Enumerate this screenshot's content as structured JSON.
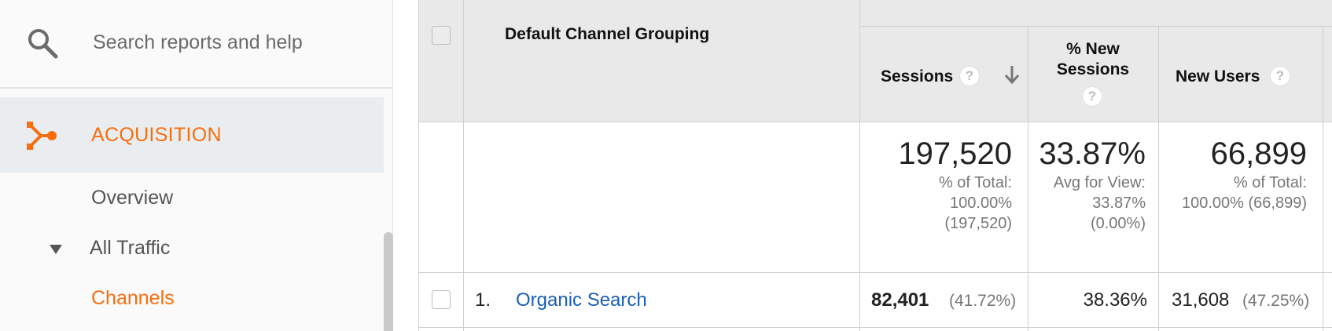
{
  "search": {
    "placeholder": "Search reports and help"
  },
  "nav": {
    "section_label": "ACQUISITION",
    "items": [
      {
        "label": "Overview"
      },
      {
        "label": "All Traffic"
      },
      {
        "label": "Channels",
        "active": true
      }
    ]
  },
  "table": {
    "dimension_header": "Default Channel Grouping",
    "columns": [
      {
        "label": "Sessions",
        "sorted": "descending"
      },
      {
        "label": "% New Sessions"
      },
      {
        "label": "New Users"
      }
    ],
    "totals": {
      "sessions": {
        "value": "197,520",
        "line1": "% of Total:",
        "line2": "100.00%",
        "line3": "(197,520)"
      },
      "new_sessions": {
        "value": "33.87%",
        "line1": "Avg for View:",
        "line2": "33.87%",
        "line3": "(0.00%)"
      },
      "new_users": {
        "value": "66,899",
        "line1": "% of Total:",
        "line2": "100.00% (66,899)"
      }
    },
    "rows": [
      {
        "index": "1.",
        "channel": "Organic Search",
        "sessions": "82,401",
        "sessions_pct": "(41.72%)",
        "new_sessions": "38.36%",
        "new_users": "31,608",
        "new_users_pct": "(47.25%)"
      }
    ]
  },
  "colors": {
    "accent": "#f76e0e",
    "link": "#1a5fb4",
    "header_bg": "#e9e9e9",
    "nav_active_bg": "#e9edf0"
  }
}
